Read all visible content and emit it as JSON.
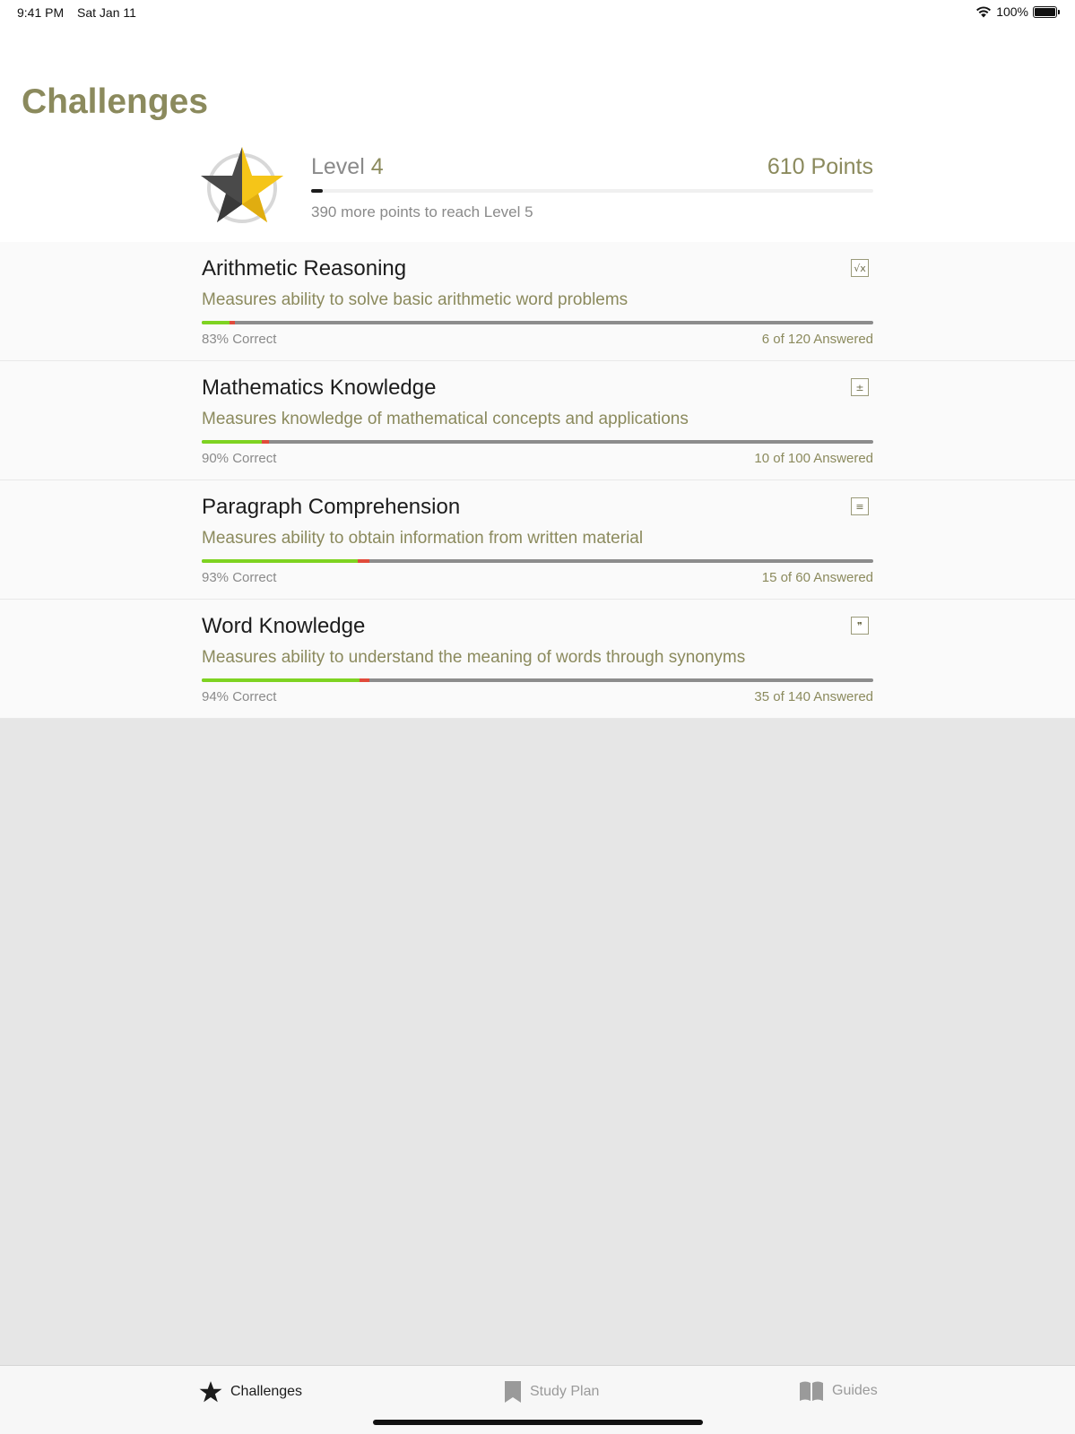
{
  "status_bar": {
    "time": "9:41 PM",
    "date": "Sat Jan 11",
    "battery": "100%"
  },
  "page": {
    "title": "Challenges"
  },
  "level": {
    "label": "Level",
    "number": "4",
    "points": "610",
    "points_label": "Points",
    "progress_fraction": 0.02,
    "subtitle": "390 more points to reach Level 5"
  },
  "challenges": [
    {
      "title": "Arithmetic Reasoning",
      "description": "Measures ability to solve basic arithmetic word problems",
      "icon": "square-root-icon",
      "icon_glyph": "√x",
      "correct": "83% Correct",
      "answered": "6 of 120",
      "answered_label": "Answered",
      "answered_fraction": 0.05,
      "correct_fraction": 0.83
    },
    {
      "title": "Mathematics Knowledge",
      "description": "Measures knowledge of mathematical concepts and applications",
      "icon": "calculator-icon",
      "icon_glyph": "±",
      "correct": "90% Correct",
      "answered": "10 of 100",
      "answered_label": "Answered",
      "answered_fraction": 0.1,
      "correct_fraction": 0.9
    },
    {
      "title": "Paragraph Comprehension",
      "description": "Measures ability to obtain information from written material",
      "icon": "paragraph-icon",
      "icon_glyph": "≡",
      "correct": "93% Correct",
      "answered": "15 of 60",
      "answered_label": "Answered",
      "answered_fraction": 0.25,
      "correct_fraction": 0.93
    },
    {
      "title": "Word Knowledge",
      "description": "Measures ability to understand the meaning of words through synonyms",
      "icon": "quote-icon",
      "icon_glyph": "❞",
      "correct": "94% Correct",
      "answered": "35 of 140",
      "answered_label": "Answered",
      "answered_fraction": 0.25,
      "correct_fraction": 0.94
    }
  ],
  "tabs": [
    {
      "label": "Challenges",
      "icon": "star-icon",
      "active": true
    },
    {
      "label": "Study Plan",
      "icon": "bookmark-icon",
      "active": false
    },
    {
      "label": "Guides",
      "icon": "book-icon",
      "active": false
    }
  ],
  "colors": {
    "accent": "#8b8a5d",
    "correct": "#7ed321",
    "wrong": "#e04b3a",
    "track": "#8c8c8c",
    "star_yellow": "#f5c518",
    "star_dark": "#4a4a4a"
  }
}
